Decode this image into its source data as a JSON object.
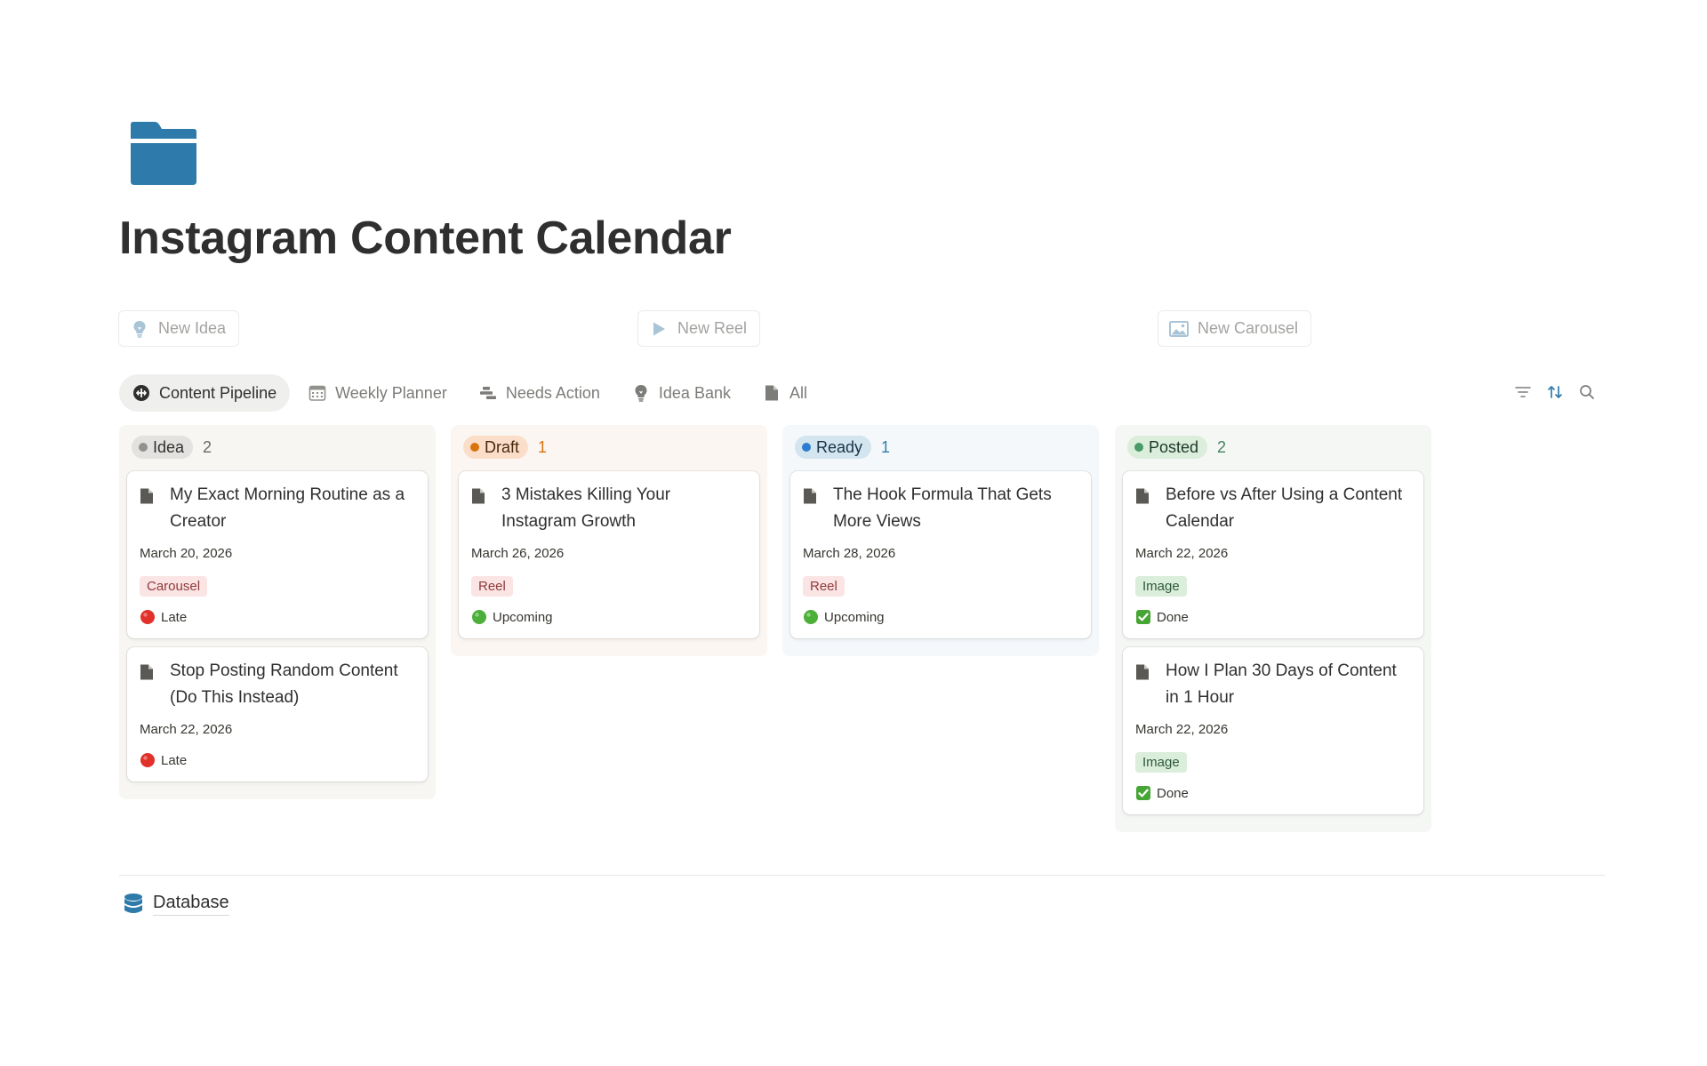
{
  "page": {
    "title": "Instagram Content Calendar",
    "icon": "folder-icon",
    "accent_color": "#2e7bab"
  },
  "quick_actions": [
    {
      "label": "New Idea",
      "icon": "lightbulb-icon"
    },
    {
      "label": "New Reel",
      "icon": "play-icon"
    },
    {
      "label": "New Carousel",
      "icon": "image-icon"
    }
  ],
  "views": {
    "tabs": [
      {
        "label": "Content Pipeline",
        "icon": "board-icon",
        "active": true
      },
      {
        "label": "Weekly Planner",
        "icon": "calendar-icon",
        "active": false
      },
      {
        "label": "Needs Action",
        "icon": "timeline-icon",
        "active": false
      },
      {
        "label": "Idea Bank",
        "icon": "lightbulb-icon",
        "active": false
      },
      {
        "label": "All",
        "icon": "document-icon",
        "active": false
      }
    ],
    "tools": [
      "filter-icon",
      "sort-icon",
      "search-icon"
    ]
  },
  "board": {
    "columns": [
      {
        "status": "Idea",
        "count": "2",
        "colors": {
          "bg": "#f7f6f3",
          "pill": "#e3e2e0",
          "dot": "#91918e",
          "text": "#32302c",
          "count": "#6b6a67"
        },
        "cards": [
          {
            "title": "My Exact Morning Routine as a Creator",
            "date": "March 20, 2026",
            "tag": "Carousel",
            "tag_style": "carousel",
            "status_emoji": "red-circle",
            "status": "Late"
          },
          {
            "title": "Stop Posting Random Content (Do This Instead)",
            "date": "March 22, 2026",
            "tag": "",
            "tag_style": "",
            "status_emoji": "red-circle",
            "status": "Late"
          }
        ]
      },
      {
        "status": "Draft",
        "count": "1",
        "colors": {
          "bg": "#fcf6f2",
          "pill": "#fadec9",
          "dot": "#d9730d",
          "text": "#49290e",
          "count": "#d9730d"
        },
        "cards": [
          {
            "title": "3 Mistakes Killing Your Instagram Growth",
            "date": "March 26, 2026",
            "tag": "Reel",
            "tag_style": "reel",
            "status_emoji": "green-circle",
            "status": "Upcoming"
          }
        ]
      },
      {
        "status": "Ready",
        "count": "1",
        "colors": {
          "bg": "#f4f8fb",
          "pill": "#d3e5ef",
          "dot": "#2e7cd1",
          "text": "#183347",
          "count": "#337ea9"
        },
        "cards": [
          {
            "title": "The Hook Formula That Gets More Views",
            "date": "March 28, 2026",
            "tag": "Reel",
            "tag_style": "reel",
            "status_emoji": "green-circle",
            "status": "Upcoming"
          }
        ]
      },
      {
        "status": "Posted",
        "count": "2",
        "colors": {
          "bg": "#f5f7f5",
          "pill": "#dbeddb",
          "dot": "#4a9a6a",
          "text": "#1c3829",
          "count": "#448361"
        },
        "cards": [
          {
            "title": "Before vs After Using a Content Calendar",
            "date": "March 22, 2026",
            "tag": "Image",
            "tag_style": "image",
            "status_emoji": "check-mark",
            "status": "Done"
          },
          {
            "title": "How I Plan 30 Days of Content in 1 Hour",
            "date": "March 22, 2026",
            "tag": "Image",
            "tag_style": "image",
            "status_emoji": "check-mark",
            "status": "Done"
          }
        ]
      }
    ]
  },
  "footer": {
    "database_label": "Database",
    "database_icon": "database-icon"
  }
}
